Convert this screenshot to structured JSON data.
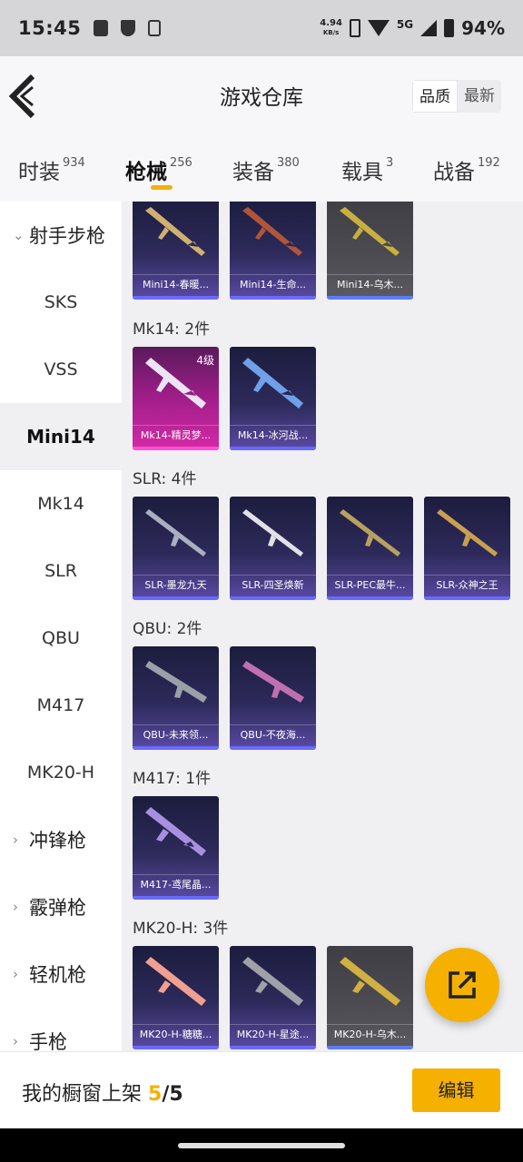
{
  "status_bar": {
    "time": "15:45",
    "net_speed_value": "4.94",
    "net_speed_unit": "KB/s",
    "network": "5G",
    "battery": "94%",
    "icons": [
      "notification-icon",
      "shield-icon",
      "phone-icon",
      "data-box-icon",
      "wifi-icon",
      "signal-icon",
      "battery-icon"
    ]
  },
  "header": {
    "title": "游戏仓库",
    "sort": {
      "options": [
        "品质",
        "最新"
      ],
      "selected": "品质"
    }
  },
  "tabs": [
    {
      "label": "时装",
      "count": "934"
    },
    {
      "label": "枪械",
      "count": "256",
      "active": true
    },
    {
      "label": "装备",
      "count": "380"
    },
    {
      "label": "载具",
      "count": "3"
    },
    {
      "label": "战备",
      "count": "192"
    }
  ],
  "sidebar": {
    "group_rifle": "射手步枪",
    "items": [
      "SKS",
      "VSS",
      "Mini14",
      "Mk14",
      "SLR",
      "QBU",
      "M417",
      "MK20-H"
    ],
    "active": "Mini14",
    "groups_collapsed": [
      "冲锋枪",
      "霰弹枪",
      "轻机枪",
      "手枪"
    ]
  },
  "sections": [
    {
      "label": "",
      "cards": [
        {
          "name": "Mini14-春暖...",
          "style": "purple"
        },
        {
          "name": "Mini14-生命...",
          "style": "purple"
        },
        {
          "name": "Mini14-乌木...",
          "style": "gray"
        }
      ]
    },
    {
      "label": "Mk14: 2件",
      "cards": [
        {
          "name": "Mk14-精灵梦...",
          "style": "pink",
          "level": "4级"
        },
        {
          "name": "Mk14-冰河战...",
          "style": "purple"
        }
      ]
    },
    {
      "label": "SLR: 4件",
      "cards": [
        {
          "name": "SLR-墨龙九天",
          "style": "purple"
        },
        {
          "name": "SLR-四圣焕新",
          "style": "purple"
        },
        {
          "name": "SLR-PEC最牛...",
          "style": "purple"
        },
        {
          "name": "SLR-众神之王",
          "style": "purple"
        }
      ]
    },
    {
      "label": "QBU: 2件",
      "cards": [
        {
          "name": "QBU-未来领...",
          "style": "purple"
        },
        {
          "name": "QBU-不夜海...",
          "style": "purple"
        }
      ]
    },
    {
      "label": "M417: 1件",
      "cards": [
        {
          "name": "M417-鸢尾晶...",
          "style": "purple"
        }
      ]
    },
    {
      "label": "MK20-H: 3件",
      "cards": [
        {
          "name": "MK20-H-糖糖...",
          "style": "purple"
        },
        {
          "name": "MK20-H-星途...",
          "style": "purple"
        },
        {
          "name": "MK20-H-乌木...",
          "style": "gray"
        }
      ]
    }
  ],
  "bottom_bar": {
    "label": "我的橱窗上架",
    "used": "5",
    "separator": "/",
    "total": "5",
    "edit_label": "编辑"
  },
  "colors": {
    "accent": "#f5b000",
    "card_purple": "#2d2a5a",
    "card_pink": "#d52aa6",
    "card_gray": "#4c4c52"
  }
}
